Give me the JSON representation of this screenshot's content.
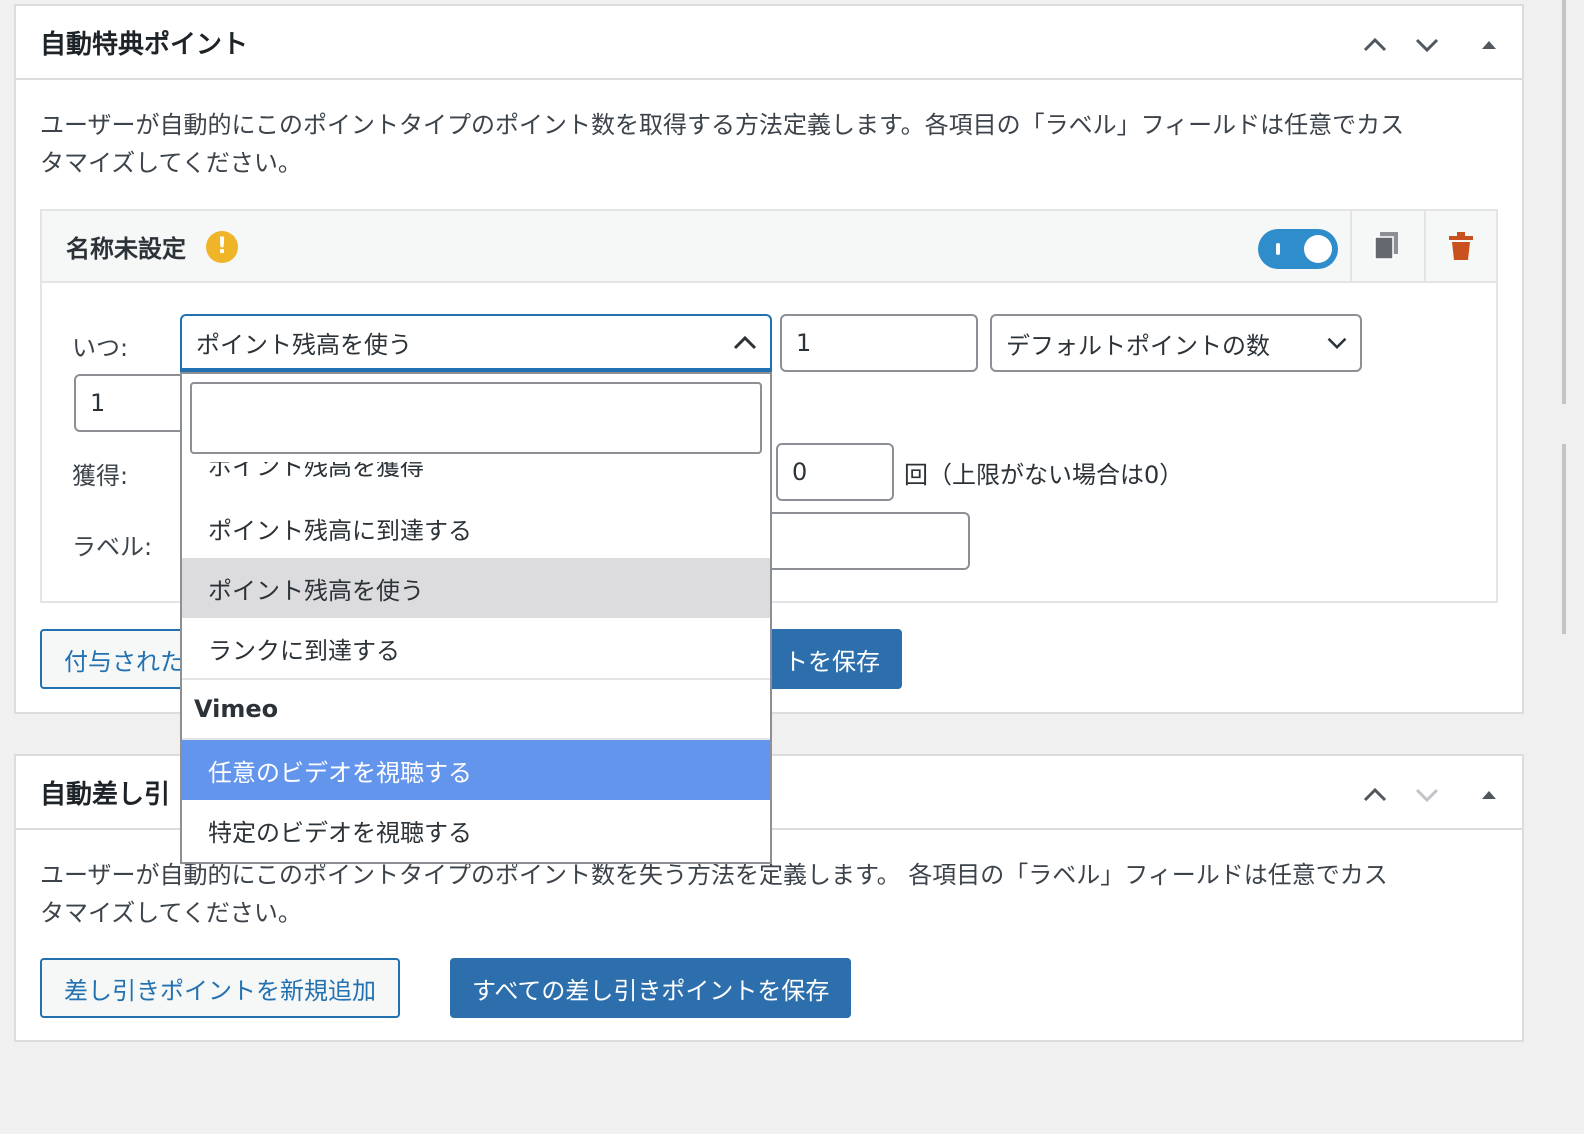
{
  "panel1": {
    "title": "自動特典ポイント",
    "description_line1": "ユーザーが自動的にこのポイントタイプのポイント数を取得する方法定義します。各項目の「ラベル」フィールドは任意でカス",
    "description_line2": "タマイズしてください。",
    "rule": {
      "title": "名称未設定",
      "warning_symbol": "!",
      "toggle_on": true,
      "when_label": "いつ:",
      "when_value": "ポイント残高を使う",
      "amount_value": "1",
      "points_type_value": "デフォルトポイントの数",
      "second_value": "1",
      "earn_label": "獲得:",
      "limit_value": "0",
      "limit_note": "回（上限がない場合は0）",
      "label_label": "ラベル:"
    },
    "add_button": "付与された",
    "save_button": "トを保存"
  },
  "dropdown": {
    "search_value": "",
    "partial_item": "ポイント残高を獲得",
    "items": [
      {
        "label": "ポイント残高に到達する",
        "state": "normal"
      },
      {
        "label": "ポイント残高を使う",
        "state": "selected"
      },
      {
        "label": "ランクに到達する",
        "state": "normal"
      }
    ],
    "group_label": "Vimeo",
    "group_items": [
      {
        "label": "任意のビデオを視聴する",
        "state": "highlighted"
      },
      {
        "label": "特定のビデオを視聴する",
        "state": "normal"
      }
    ]
  },
  "panel2": {
    "title": "自動差し引",
    "description_line1": "ユーザーが自動的にこのポイントタイプのポイント数を失う方法を定義します。 各項目の「ラベル」フィールドは任意でカス",
    "description_line2": "タマイズしてください。",
    "add_button": "差し引きポイントを新規追加",
    "save_button": "すべての差し引きポイントを保存"
  },
  "colors": {
    "accent": "#2271b1",
    "primary_button": "#2d6fac",
    "toggle": "#2f8dcb",
    "warning": "#f0b429",
    "delete": "#c9511f",
    "highlight": "#6495ed",
    "selected": "#dcdcde"
  }
}
